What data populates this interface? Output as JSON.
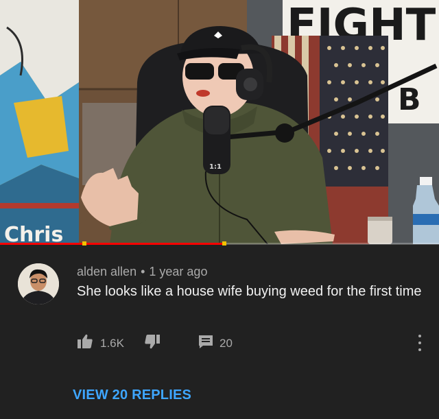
{
  "video": {
    "thumbnail": "podcast-guest-frame",
    "sign_text": "FIGHT",
    "sign_lower_text": "B",
    "painting_text": "Chris",
    "mic_label": "1:1",
    "progress_fraction": 0.51
  },
  "comment": {
    "author": "alden allen",
    "separator": "•",
    "time": "1 year ago",
    "text": "She looks like a house wife buying weed for the first time",
    "likes": "1.6K",
    "replies_count": "20",
    "like_icon": "thumbs-up-icon",
    "dislike_icon": "thumbs-down-icon",
    "reply_icon": "comment-icon",
    "more_icon": "more-vertical-icon"
  },
  "view_replies": "VIEW 20 REPLIES",
  "colors": {
    "background": "#212121",
    "link": "#3ea6ff",
    "secondary_text": "#aaaaaa",
    "primary_text": "#f1f1f1",
    "progress": "#ff0000"
  }
}
